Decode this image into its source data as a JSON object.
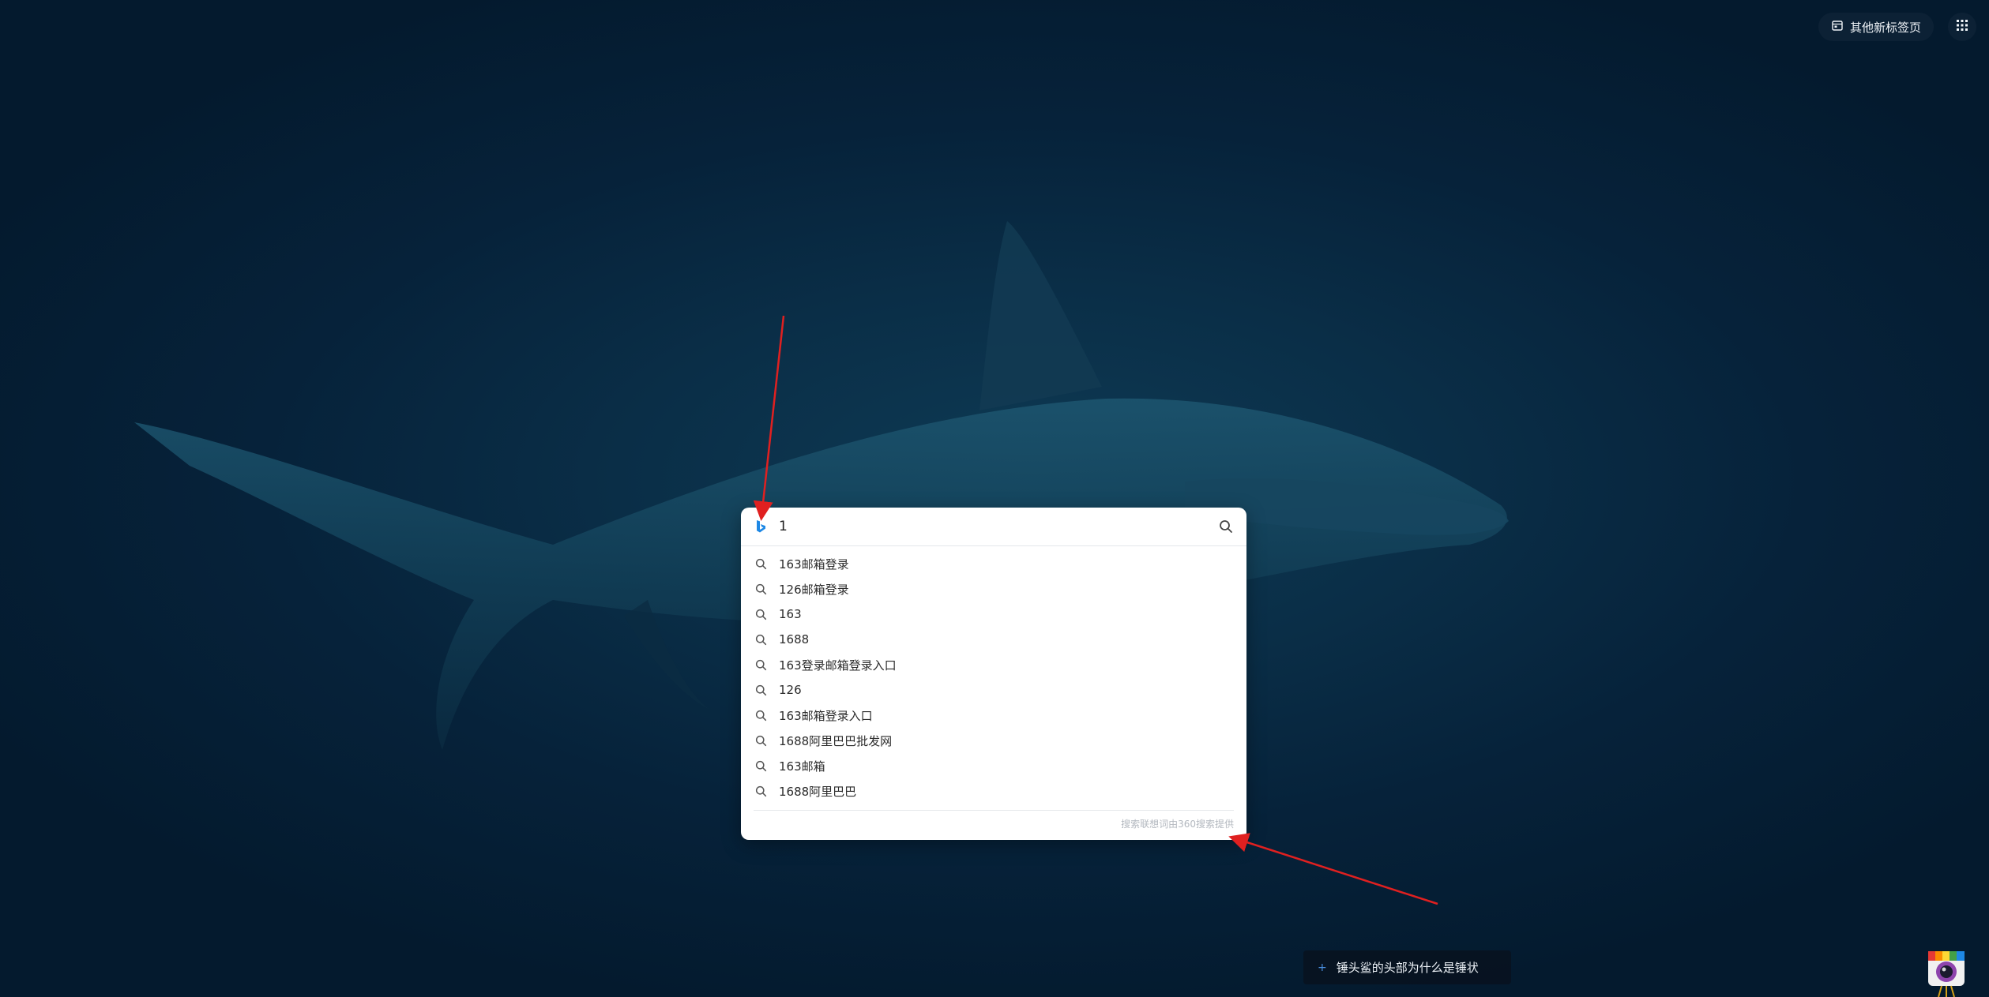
{
  "header": {
    "other_tabs_label": "其他新标签页",
    "other_tabs_icon": "calendar-tab-icon",
    "apps_icon": "grid-apps-icon"
  },
  "search": {
    "engine_icon": "bing-logo-icon",
    "query": "1",
    "submit_icon": "search-icon",
    "suggestions": [
      "163邮箱登录",
      "126邮箱登录",
      "163",
      "1688",
      "163登录邮箱登录入口",
      "126",
      "163邮箱登录入口",
      "1688阿里巴巴批发网",
      "163邮箱",
      "1688阿里巴巴"
    ],
    "provider_note": "搜索联想词由360搜索提供"
  },
  "info_pill": {
    "label": "锤头鲨的头部为什么是锤状"
  },
  "colors": {
    "background": "#06223a",
    "panel": "#ffffff",
    "accent_blue": "#1e88e5",
    "annotation_red": "#e02020"
  }
}
